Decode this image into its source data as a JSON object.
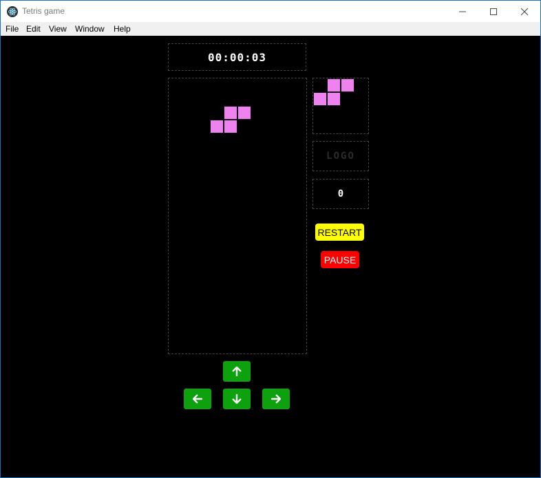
{
  "window": {
    "title": "Tetris game"
  },
  "menu": {
    "file": "File",
    "edit": "Edit",
    "view": "View",
    "window": "Window",
    "help": "Help"
  },
  "game": {
    "timer": "00:00:03",
    "logo": "LOGO",
    "score": "0",
    "restart_label": "RESTART",
    "pause_label": "PAUSE",
    "piece_color": "#ee82ee",
    "board_cols": 10,
    "board_rows": 20,
    "active_piece": {
      "shape": "S",
      "cells": [
        [
          4,
          2
        ],
        [
          5,
          2
        ],
        [
          3,
          3
        ],
        [
          4,
          3
        ]
      ]
    },
    "next_piece": {
      "shape": "S",
      "cells": [
        [
          1,
          0
        ],
        [
          2,
          0
        ],
        [
          0,
          1
        ],
        [
          1,
          1
        ]
      ]
    }
  },
  "controls": {
    "up_icon": "arrow-up-icon",
    "left_icon": "arrow-left-icon",
    "down_icon": "arrow-down-icon",
    "right_icon": "arrow-right-icon"
  },
  "colors": {
    "restart": "#ffff00",
    "pause": "#ff0000",
    "arrow_buttons": "#0da20d",
    "background": "#000000"
  }
}
